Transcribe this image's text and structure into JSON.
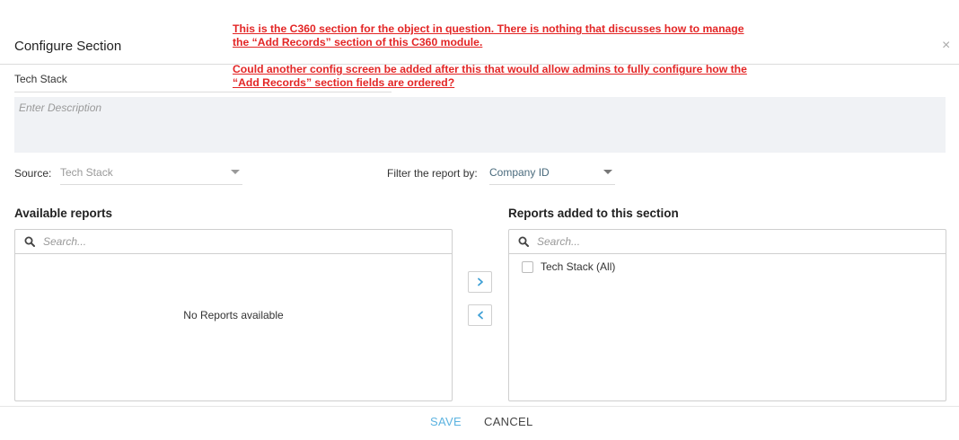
{
  "dialog": {
    "title": "Configure Section",
    "close_glyph": "×"
  },
  "annotations": {
    "note1_line1": "This is the C360 section for the object in question. There is nothing that discusses how to manage",
    "note1_line2": "the “Add Records” section of this C360 module.",
    "note2_line1": "Could another config screen be added after this that would allow admins to fully configure how the",
    "note2_line2": "“Add Records” section fields are ordered?",
    "color": "#e32626"
  },
  "form": {
    "section_name": "Tech Stack",
    "description_placeholder": "Enter Description",
    "source_label": "Source:",
    "source_value": "Tech Stack",
    "filter_label": "Filter the report by:",
    "filter_value": "Company ID"
  },
  "available_reports": {
    "heading": "Available reports",
    "search_placeholder": "Search...",
    "empty_text": "No Reports available"
  },
  "added_reports": {
    "heading": "Reports added to this section",
    "search_placeholder": "Search...",
    "items": [
      {
        "label": "Tech Stack (All)",
        "checked": false
      }
    ]
  },
  "transfer_buttons": {
    "move_right_icon": "chevron-right-icon",
    "move_left_icon": "chevron-left-icon"
  },
  "footer": {
    "save_label": "SAVE",
    "cancel_label": "CANCEL"
  },
  "colors": {
    "accent": "#5cb3e0",
    "annotation_red": "#e32626"
  }
}
